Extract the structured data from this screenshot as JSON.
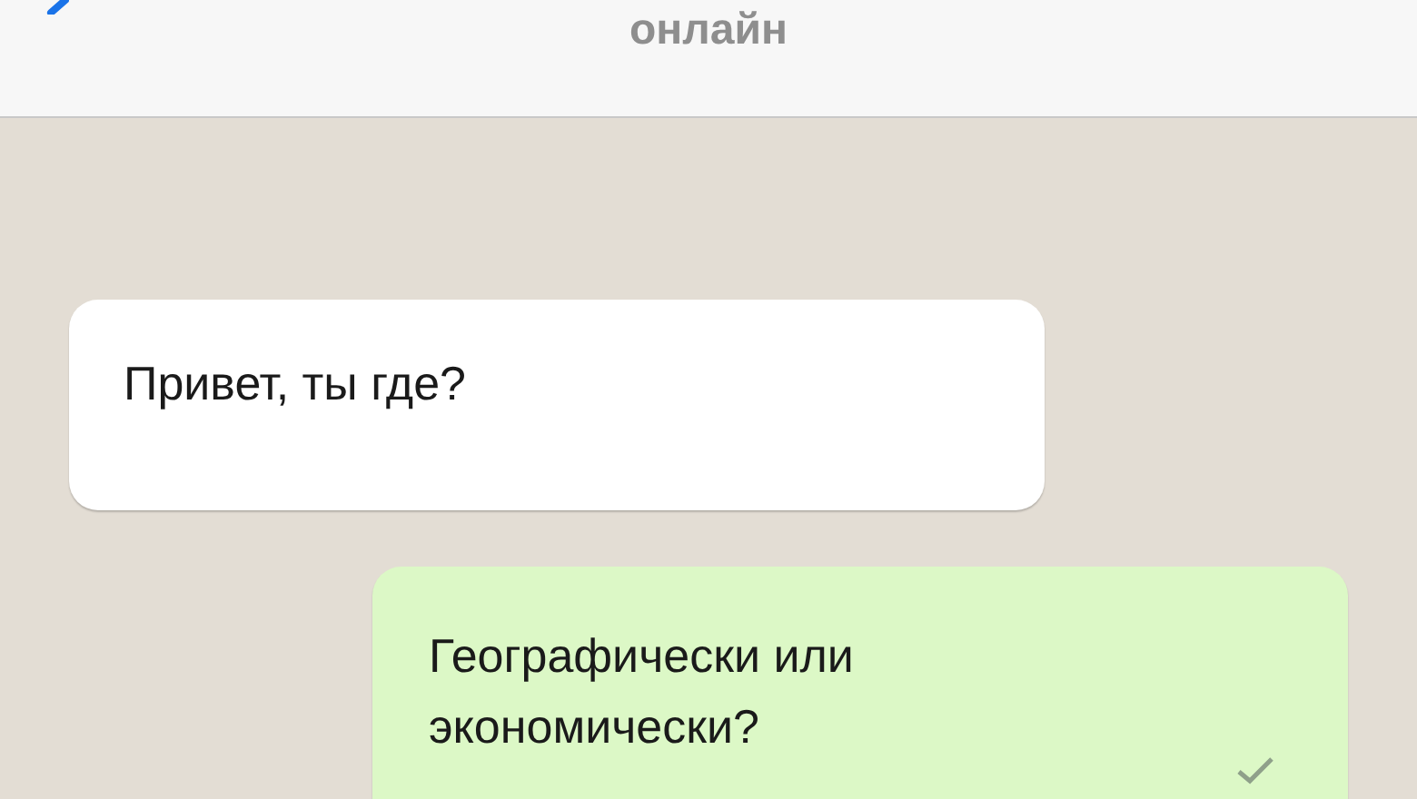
{
  "header": {
    "status": "онлайн"
  },
  "messages": [
    {
      "kind": "incoming",
      "text": "Привет, ты где?"
    },
    {
      "kind": "outgoing",
      "text": "Географически или экономически?",
      "delivered": true
    }
  ]
}
